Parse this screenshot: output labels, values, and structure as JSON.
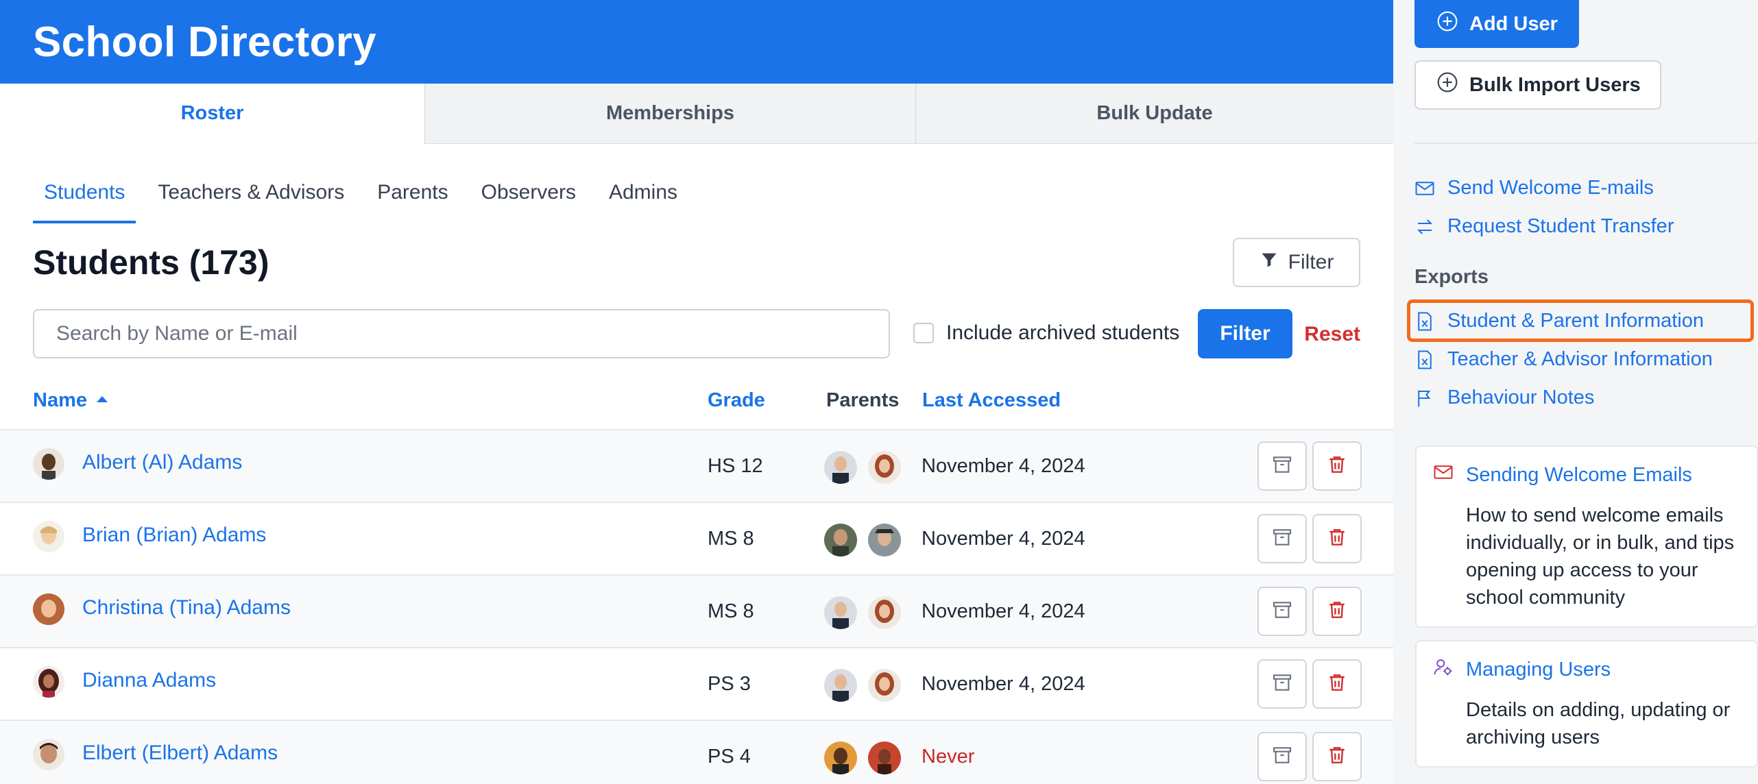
{
  "header": {
    "title": "School Directory"
  },
  "top_tabs": [
    "Roster",
    "Memberships",
    "Bulk Update"
  ],
  "sub_tabs": [
    "Students",
    "Teachers & Advisors",
    "Parents",
    "Observers",
    "Admins"
  ],
  "section": {
    "title": "Students (173)",
    "filter_label": "Filter"
  },
  "search": {
    "placeholder": "Search by Name or E-mail",
    "include_archived_label": "Include archived students",
    "filter_button": "Filter",
    "reset_link": "Reset"
  },
  "columns": {
    "name": "Name",
    "grade": "Grade",
    "parents": "Parents",
    "last_accessed": "Last Accessed"
  },
  "students": [
    {
      "name": "Albert (Al) Adams",
      "grade": "HS 12",
      "last_accessed": "November 4, 2024",
      "never": false
    },
    {
      "name": "Brian (Brian) Adams",
      "grade": "MS 8",
      "last_accessed": "November 4, 2024",
      "never": false
    },
    {
      "name": "Christina (Tina) Adams",
      "grade": "MS 8",
      "last_accessed": "November 4, 2024",
      "never": false
    },
    {
      "name": "Dianna Adams",
      "grade": "PS 3",
      "last_accessed": "November 4, 2024",
      "never": false
    },
    {
      "name": "Elbert (Elbert) Adams",
      "grade": "PS 4",
      "last_accessed": "Never",
      "never": true
    }
  ],
  "sidebar": {
    "add_user": "Add User",
    "bulk_import": "Bulk Import Users",
    "send_welcome": "Send Welcome E-mails",
    "request_transfer": "Request Student Transfer",
    "exports_heading": "Exports",
    "export_student_parent": "Student & Parent Information",
    "export_teacher_advisor": "Teacher & Advisor Information",
    "export_behaviour": "Behaviour Notes",
    "help_cards": [
      {
        "title": "Sending Welcome Emails",
        "desc": "How to send welcome emails individually, or in bulk, and tips opening up access to your school community"
      },
      {
        "title": "Managing Users",
        "desc": "Details on adding, updating or archiving users"
      }
    ]
  },
  "colors": {
    "primary": "#1a73e8",
    "danger": "#d32f2f",
    "highlight": "#f26b1d"
  }
}
